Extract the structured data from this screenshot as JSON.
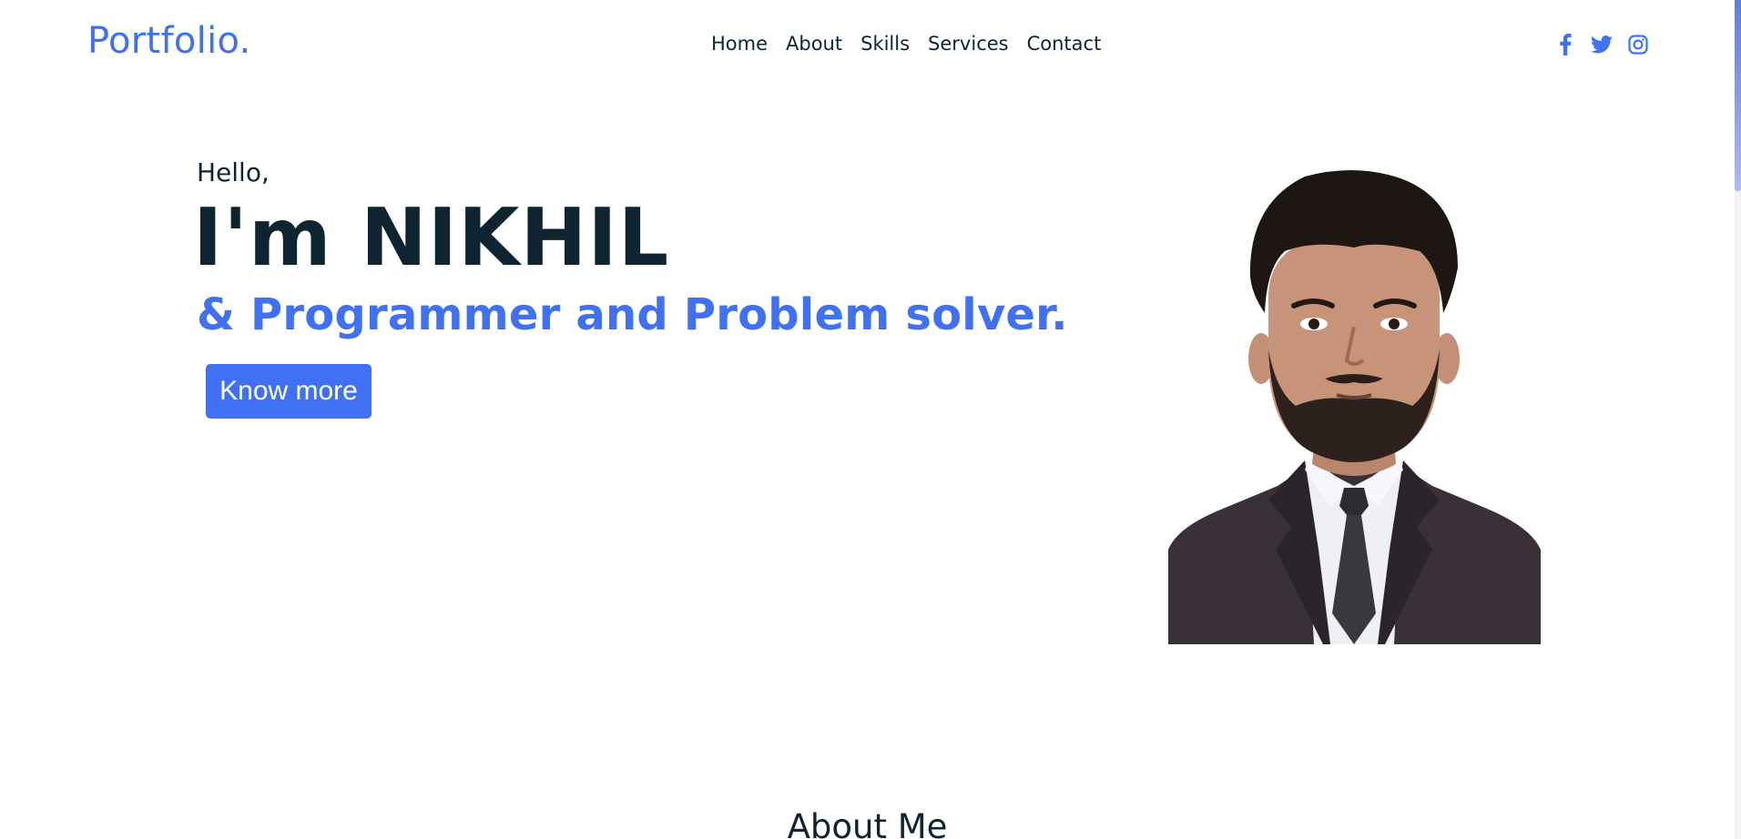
{
  "header": {
    "logo": "Portfolio.",
    "nav": [
      "Home",
      "About",
      "Skills",
      "Services",
      "Contact"
    ],
    "social_icons": [
      "facebook-icon",
      "twitter-icon",
      "instagram-icon"
    ]
  },
  "hero": {
    "greeting": "Hello,",
    "name": "I'm NIKHIL",
    "tagline": "& Programmer and Problem solver.",
    "button_label": "Know more"
  },
  "about": {
    "title": "About Me"
  },
  "colors": {
    "accent": "#4070f4",
    "text_dark": "#0e2431",
    "background": "#ffffff"
  }
}
